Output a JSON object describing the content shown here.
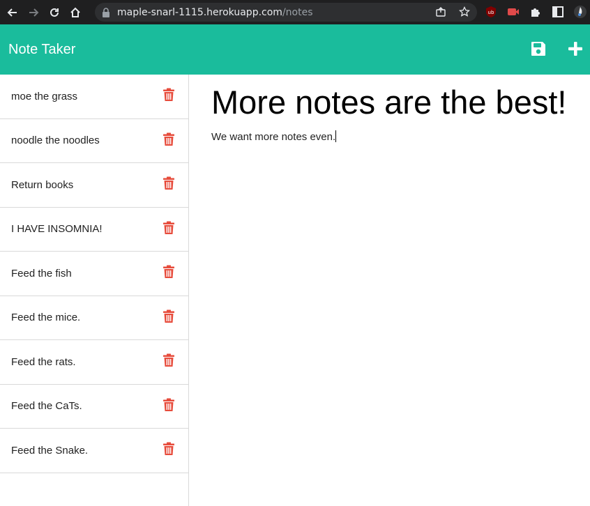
{
  "browser": {
    "url_host": "maple-snarl-1115.herokuapp.com",
    "url_path": "/notes",
    "ext_ublock_label": "ub"
  },
  "header": {
    "brand": "Note Taker"
  },
  "notes": [
    {
      "title": "moe the grass"
    },
    {
      "title": "noodle the noodles"
    },
    {
      "title": "Return books"
    },
    {
      "title": "I HAVE INSOMNIA!"
    },
    {
      "title": "Feed the fish"
    },
    {
      "title": "Feed the mice."
    },
    {
      "title": "Feed the rats."
    },
    {
      "title": "Feed the CaTs."
    },
    {
      "title": "Feed the Snake."
    }
  ],
  "active_note": {
    "title": "More notes are the best!",
    "text": "We want more notes even."
  },
  "colors": {
    "accent": "#1abc9c",
    "delete": "#e74c3c"
  }
}
